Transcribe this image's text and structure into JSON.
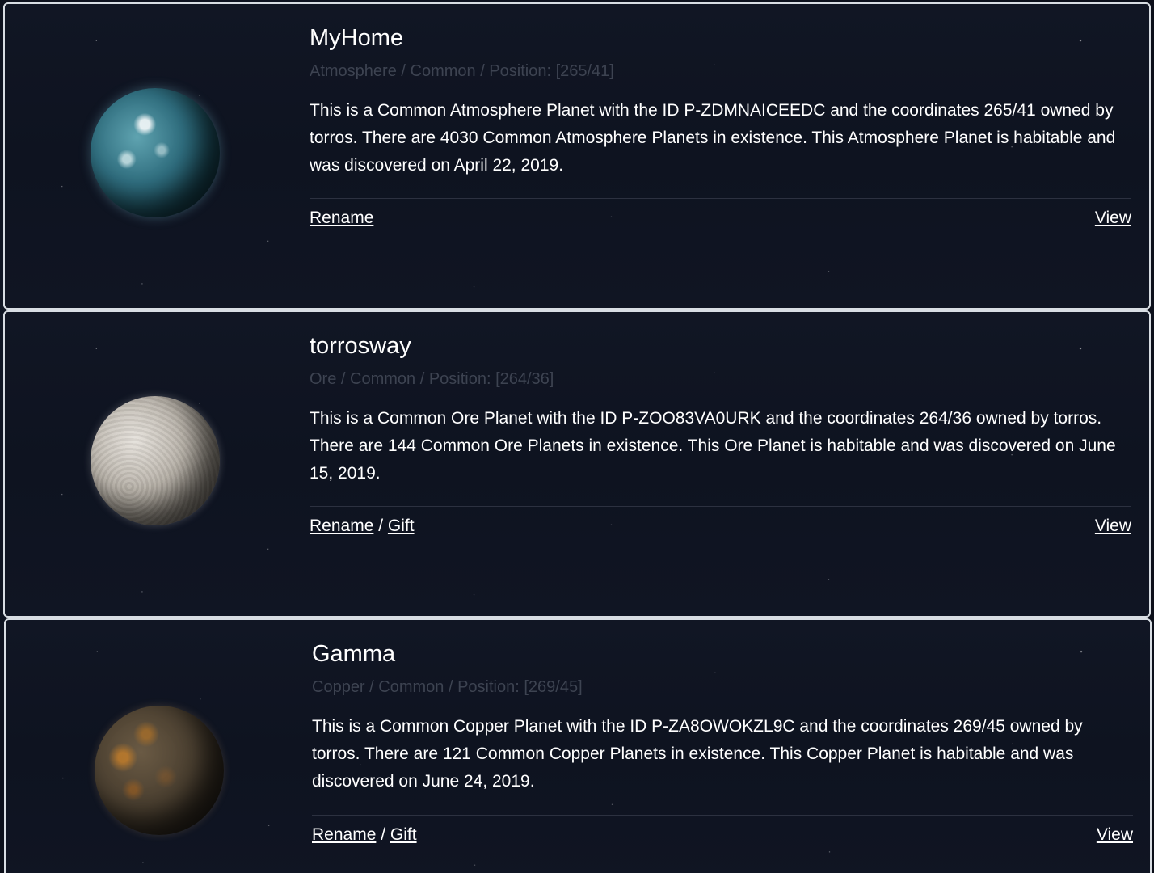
{
  "planets": [
    {
      "name": "MyHome",
      "subtitle": "Atmosphere / Common / Position: [265/41]",
      "description": "This is a Common Atmosphere Planet with the ID P-ZDMNAICEEDC and the coordinates 265/41 owned by torros. There are 4030 Common Atmosphere Planets in existence. This Atmosphere Planet is habitable and was discovered on April 22, 2019.",
      "rename_label": "Rename",
      "view_label": "View",
      "image": "atmosphere-planet-image"
    },
    {
      "name": "torrosway",
      "subtitle": "Ore / Common / Position: [264/36]",
      "description": "This is a Common Ore Planet with the ID P-ZOO83VA0URK and the coordinates 264/36 owned by torros. There are 144 Common Ore Planets in existence. This Ore Planet is habitable and was discovered on June 15, 2019.",
      "rename_label": "Rename",
      "separator": "/",
      "gift_label": "Gift",
      "view_label": "View",
      "image": "ore-planet-image"
    },
    {
      "name": "Gamma",
      "subtitle": "Copper / Common / Position: [269/45]",
      "description": "This is a Common Copper Planet with the ID P-ZA8OWOKZL9C and the coordinates 269/45 owned by torros. There are 121 Common Copper Planets in existence. This Copper Planet is habitable and was discovered on June 24, 2019.",
      "rename_label": "Rename",
      "separator": "/",
      "gift_label": "Gift",
      "view_label": "View",
      "image": "copper-planet-image"
    }
  ],
  "colors": {
    "background": "#0d111d",
    "card_border": "#d8dde3",
    "subtitle": "#3d4351",
    "text": "#ffffff"
  }
}
